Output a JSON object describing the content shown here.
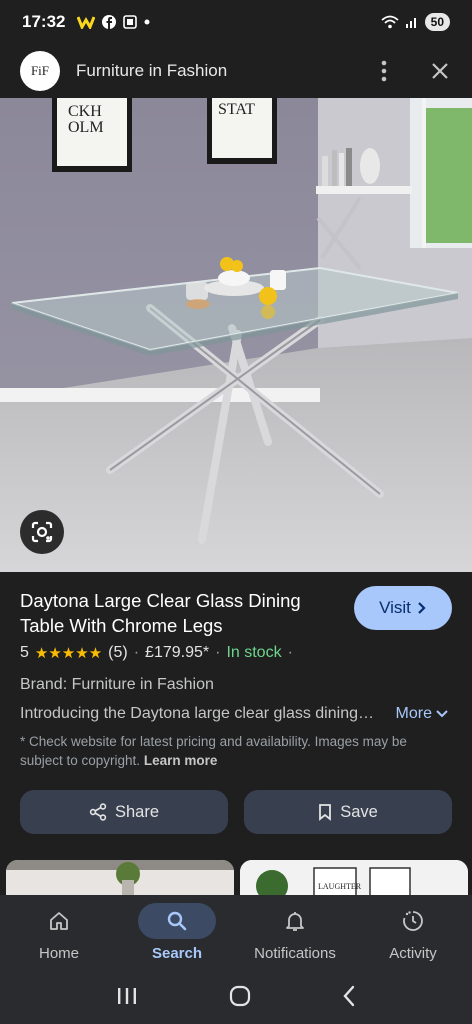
{
  "status_bar": {
    "time": "17:32",
    "battery": "50"
  },
  "header": {
    "logo_text": "FiF",
    "site_name": "Furniture in Fashion"
  },
  "product": {
    "title": "Daytona Large Clear Glass Dining Table With Chrome Legs",
    "visit_label": "Visit",
    "rating_value": "5",
    "stars": "★★★★★",
    "review_count": "(5)",
    "sep1": "·",
    "price": "£179.95*",
    "sep2": "·",
    "stock": "In stock",
    "sep3": "·",
    "brand": "Brand: Furniture in Fashion",
    "description": "Introducing the Daytona large clear glass dining table",
    "more_label": "More",
    "disclaimer": "* Check website for latest pricing and availability. Images may be subject to copyright.",
    "learn_more": "Learn more",
    "share_label": "Share",
    "save_label": "Save"
  },
  "thumbnails": {
    "text_a": "LAUGHTER"
  },
  "bottom_nav": [
    {
      "label": "Home",
      "icon": "home-icon"
    },
    {
      "label": "Search",
      "icon": "search-icon"
    },
    {
      "label": "Notifications",
      "icon": "bell-icon"
    },
    {
      "label": "Activity",
      "icon": "activity-icon"
    }
  ],
  "colors": {
    "accent": "#a8c7fa",
    "in_stock": "#6dd58c",
    "stars": "#fbbc04",
    "background": "#1f1f1f"
  }
}
